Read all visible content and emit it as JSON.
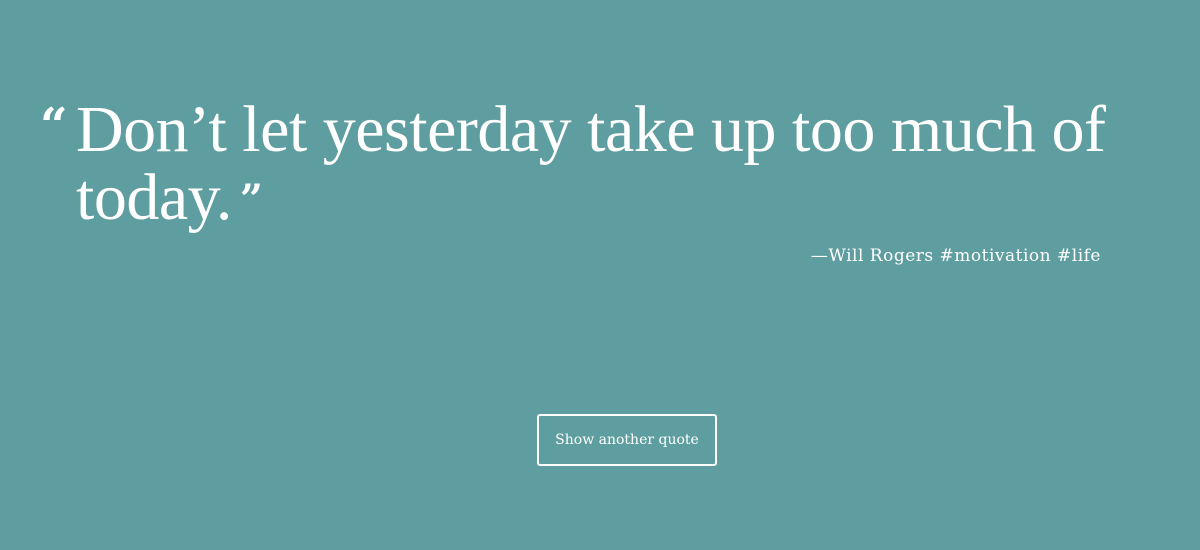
{
  "quote": {
    "open_mark": "“",
    "text": "Don’t let yesterday take up too much of today.",
    "close_mark": "”",
    "author": "—Will Rogers",
    "tags": [
      "#motivation",
      "#life"
    ]
  },
  "actions": {
    "new_quote_label": "Show another quote"
  },
  "colors": {
    "background": "#5f9ea0",
    "text": "#ffffff"
  }
}
